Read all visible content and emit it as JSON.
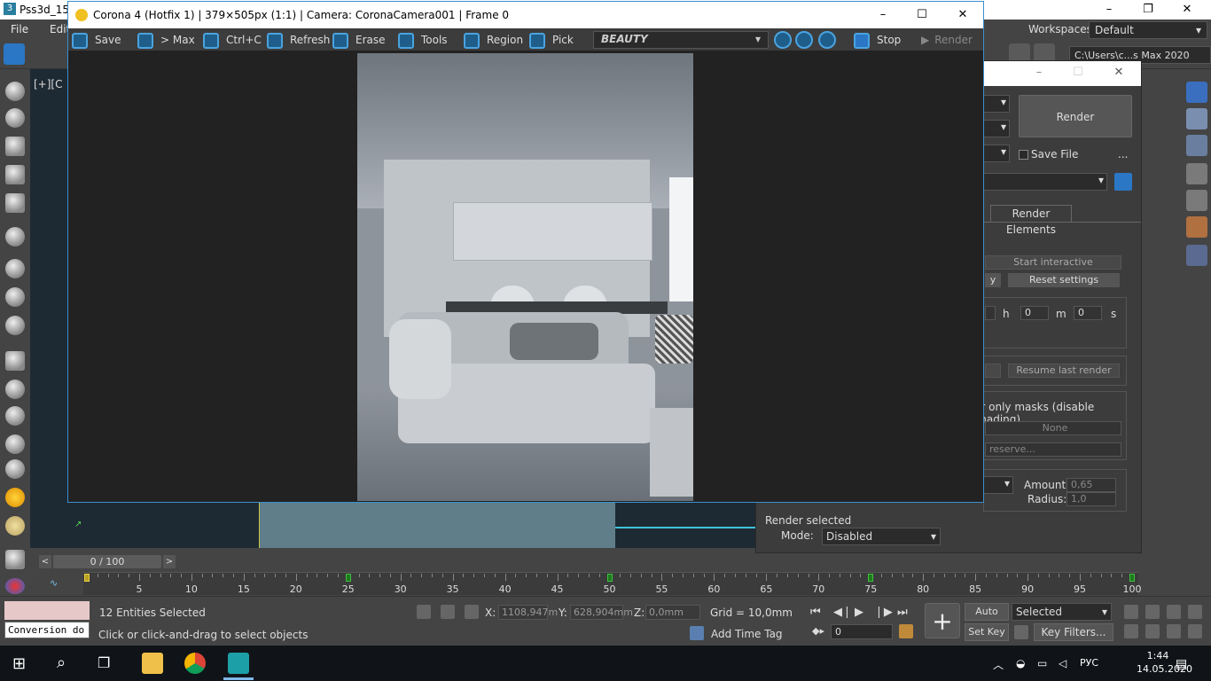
{
  "max": {
    "title": "Pss3d_15-",
    "menu": [
      "File",
      "Edit"
    ],
    "workspace_label": "Workspaces:",
    "workspace_value": "Default",
    "project_path": "C:\\Users\\c...s Max 2020",
    "viewport_label": "[+][C"
  },
  "vfb": {
    "title": "Corona 4 (Hotfix 1) | 379×505px (1:1) | Camera: CoronaCamera001 | Frame 0",
    "toolbar": {
      "save": "Save",
      "to_max": "> Max",
      "copy": "Ctrl+C",
      "refresh": "Refresh",
      "erase": "Erase",
      "tools": "Tools",
      "region": "Region",
      "pick": "Pick",
      "channel": "BEAUTY",
      "stop": "Stop",
      "render": "Render"
    }
  },
  "render_setup": {
    "render_button": "Render",
    "save_file": "Save File",
    "dots": "...",
    "tab": "Render Elements",
    "start_interactive": "Start interactive",
    "y_btn": "y",
    "reset_settings": "Reset settings",
    "time_h": "h",
    "time_m": "m",
    "time_s": "s",
    "h_val": "0",
    "m_val": "0",
    "s_val": "0",
    "resume_last_render": "Resume last render",
    "masks_text": "er only masks (disable shading)",
    "none_field": "None",
    "reserve_field": "reserve...",
    "amount_label": "Amount:",
    "amount_value": "0,65",
    "radius_label": "Radius:",
    "radius_value": "1,0",
    "render_selected": "Render selected",
    "mode_label": "Mode:",
    "mode_value": "Disabled"
  },
  "timeline": {
    "slider_text": "0 / 100",
    "prev": "<",
    "next": ">",
    "ticks": [
      "5",
      "10",
      "15",
      "20",
      "25",
      "30",
      "35",
      "40",
      "45",
      "50",
      "55",
      "60",
      "65",
      "70",
      "75",
      "80",
      "85",
      "90",
      "95",
      "100"
    ],
    "keys_at": [
      0,
      25,
      50,
      75,
      100
    ]
  },
  "status": {
    "maxscript_text": "Conversion do",
    "entities_selected": "12 Entities Selected",
    "prompt": "Click or click-and-drag to select objects",
    "x_label": "X:",
    "x_value": "1108,947m",
    "y_label": "Y:",
    "y_value": "628,904mm",
    "z_label": "Z:",
    "z_value": "0,0mm",
    "grid": "Grid = 10,0mm",
    "add_time_tag": "Add Time Tag",
    "frame_value": "0",
    "auto_key": "Auto Key",
    "set_key": "Set Key",
    "key_mode": "Selected",
    "key_filters": "Key Filters..."
  },
  "taskbar": {
    "lang": "РУС",
    "time": "1:44",
    "date": "14.05.2020"
  }
}
